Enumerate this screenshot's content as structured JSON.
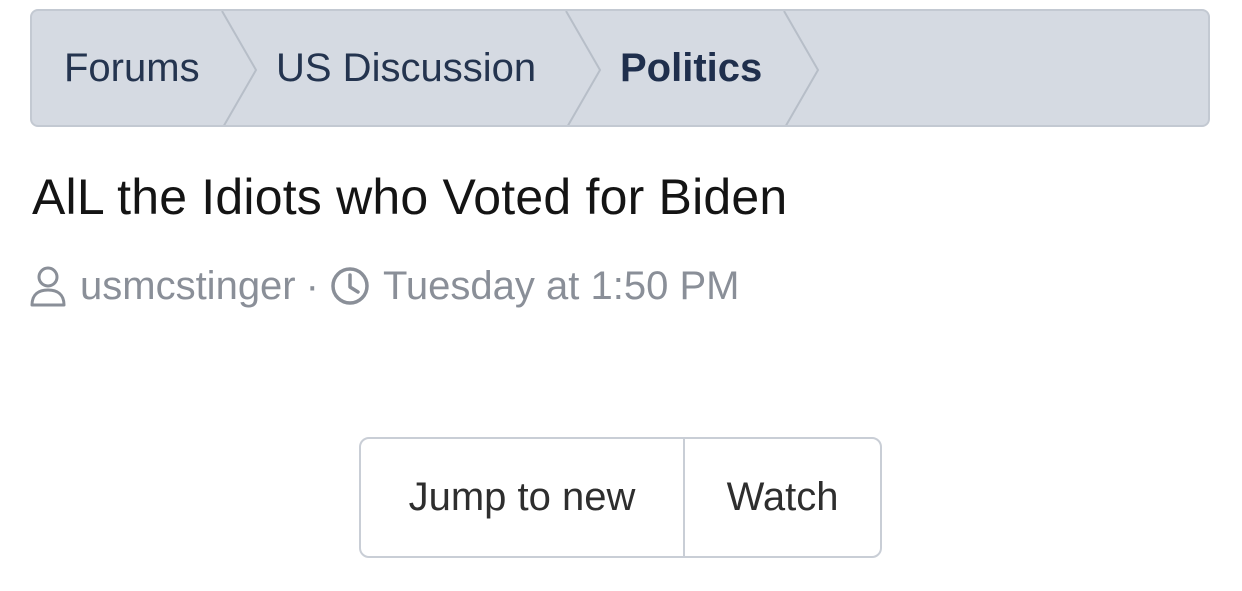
{
  "breadcrumb": {
    "items": [
      {
        "label": "Forums"
      },
      {
        "label": "US Discussion"
      },
      {
        "label": "Politics"
      }
    ]
  },
  "thread": {
    "title": "AlL the Idiots who Voted for Biden",
    "author": "usmcstinger",
    "separator": "·",
    "posted": "Tuesday at 1:50 PM",
    "author_icon": "user-icon",
    "time_icon": "clock-icon"
  },
  "actions": {
    "jump_label": "Jump to new",
    "watch_label": "Watch"
  },
  "colors": {
    "breadcrumb_bg": "#d5dae2",
    "breadcrumb_text": "#24344f",
    "meta_text": "#8a8f98",
    "title_text": "#141414"
  }
}
